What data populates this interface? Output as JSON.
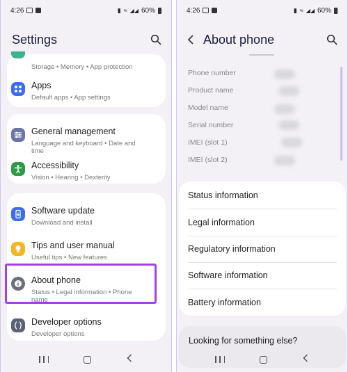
{
  "status": {
    "time": "4:26",
    "battery": "60%"
  },
  "settings": {
    "title": "Settings",
    "rows": [
      {
        "title": "",
        "subtitle": "Storage  •  Memory  •  App protection"
      },
      {
        "title": "Apps",
        "subtitle": "Default apps  •  App settings",
        "color": "#3d6cf2"
      },
      {
        "title": "General management",
        "subtitle": "Language and keyboard  •  Date and time",
        "color": "#6c74a8"
      },
      {
        "title": "Accessibility",
        "subtitle": "Vision  •  Hearing  •  Dexterity",
        "color": "#2f9a48"
      },
      {
        "title": "Software update",
        "subtitle": "Download and install",
        "color": "#3d6cf2"
      },
      {
        "title": "Tips and user manual",
        "subtitle": "Useful tips  •  New features",
        "color": "#f3b723"
      },
      {
        "title": "About phone",
        "subtitle": "Status  •  Legal information  •  Phone name",
        "color": "#6b6f7d"
      },
      {
        "title": "Developer options",
        "subtitle": "Developer options",
        "color": "#5c6175"
      }
    ],
    "highlight_color": "#a440e8"
  },
  "about": {
    "title": "About phone",
    "info_labels": [
      "Phone number",
      "Product name",
      "Model name",
      "Serial number",
      "IMEI (slot 1)",
      "IMEI (slot 2)"
    ],
    "menu": [
      "Status information",
      "Legal information",
      "Regulatory information",
      "Software information",
      "Battery information"
    ],
    "looking": "Looking for something else?"
  }
}
